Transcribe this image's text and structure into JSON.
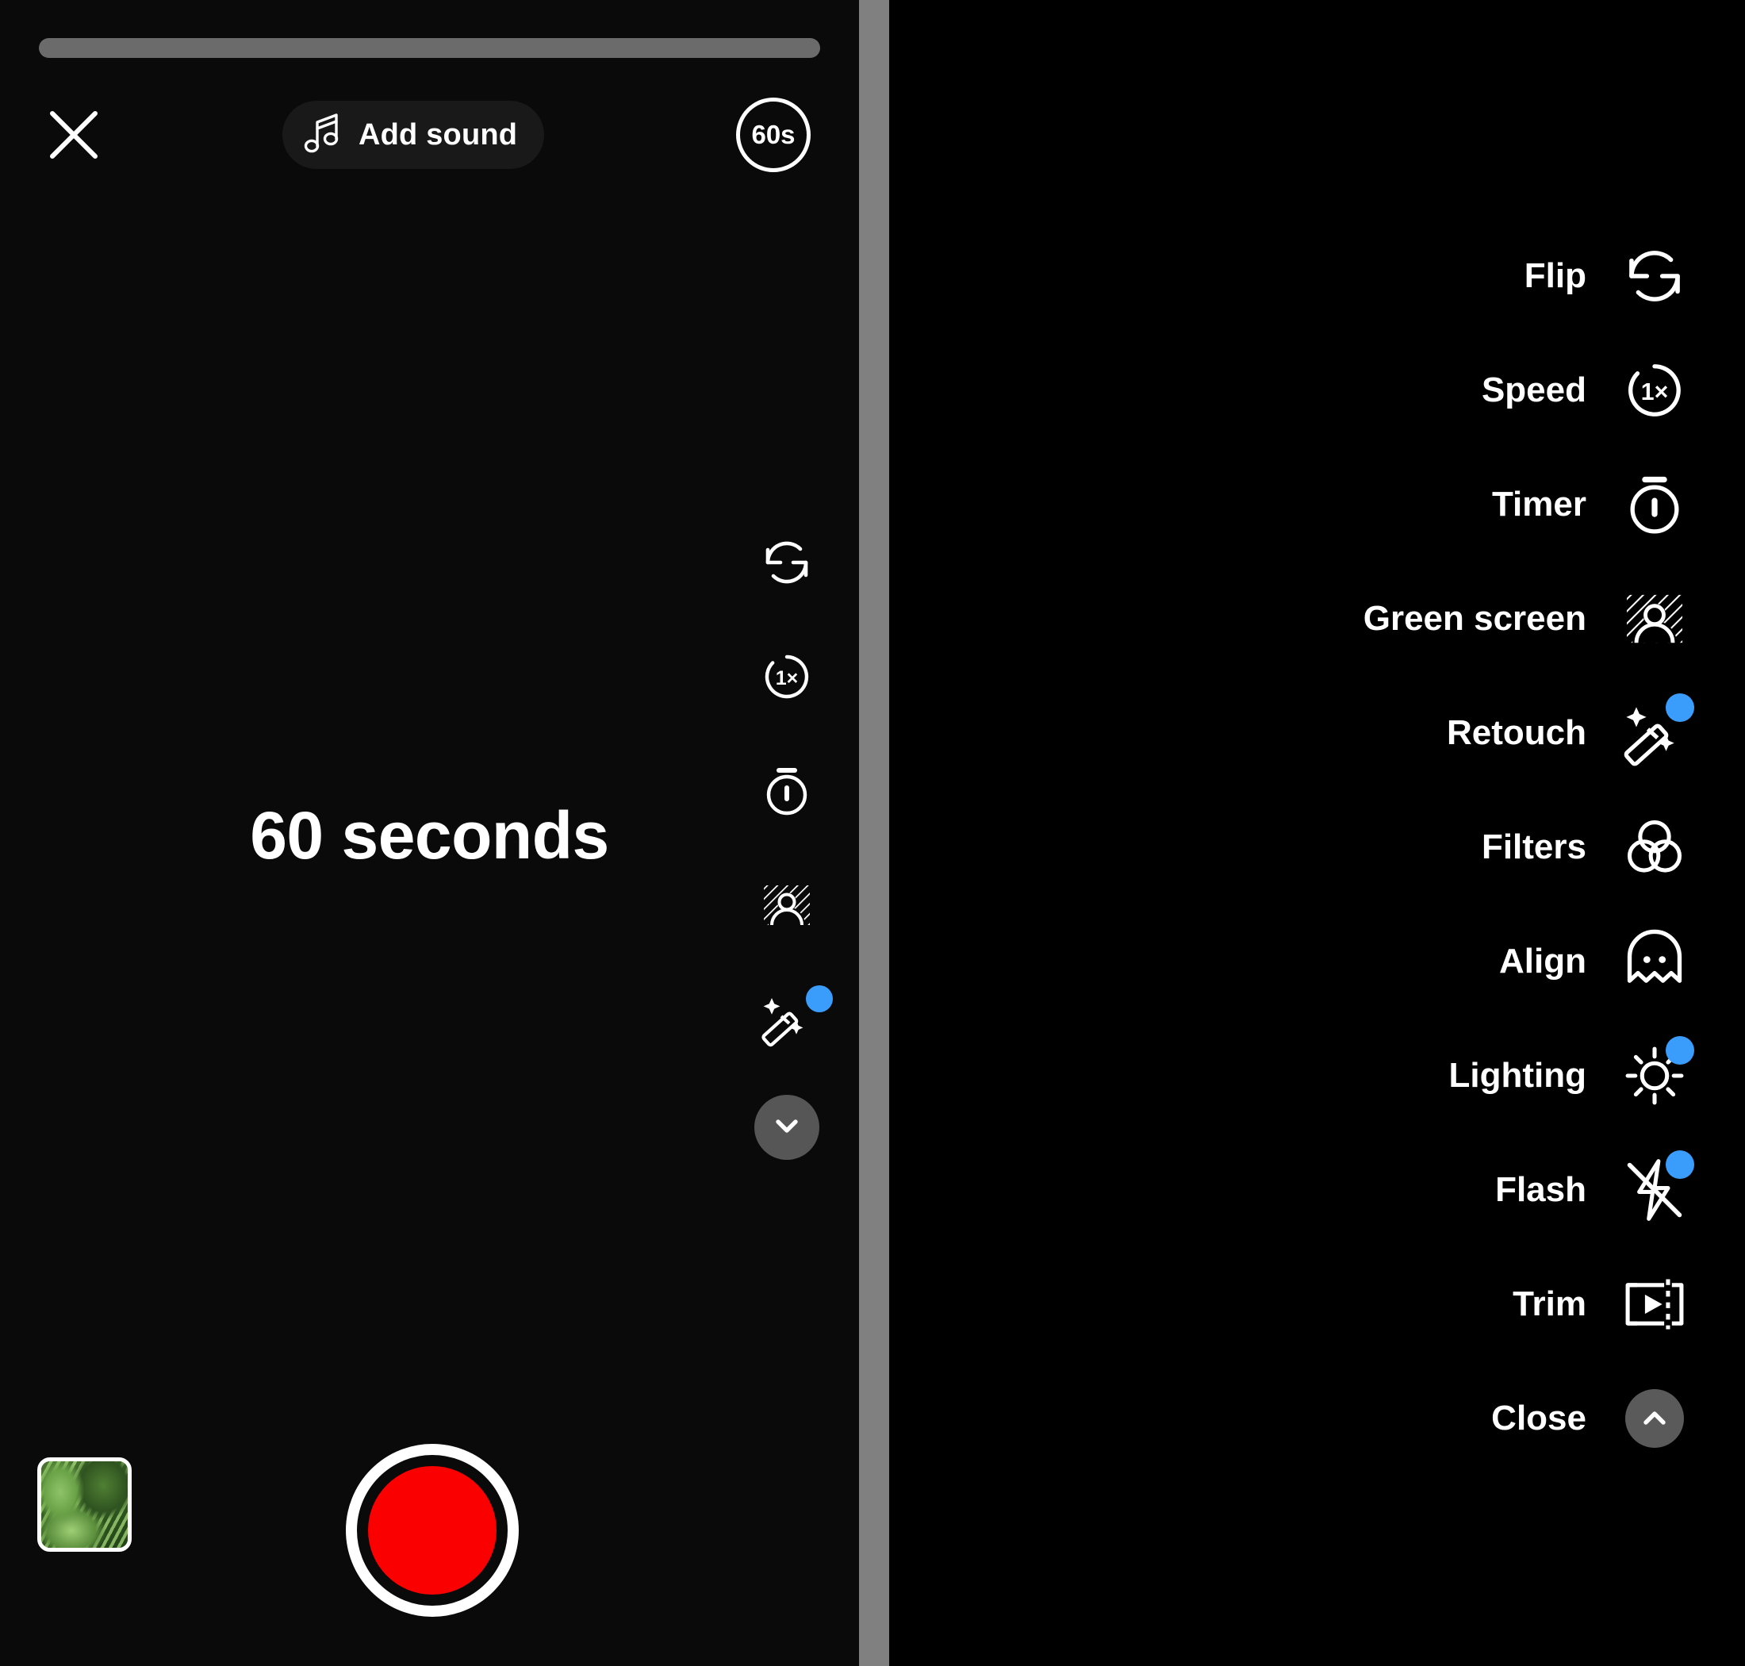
{
  "app": {
    "screen_name": "Camera recorder",
    "accent_badge_color": "#3b9dfb",
    "record_color": "#fa0000",
    "divider_color": "#808080"
  },
  "camera": {
    "progress": {
      "name": "recording-progress",
      "value_percent": 100,
      "track_color": "#6b6b6b"
    },
    "top_bar": {
      "close_label": "Close",
      "add_sound_label": "Add sound",
      "add_sound_icon": "music-note-icon",
      "duration_label": "60s"
    },
    "countdown_text": "60 seconds",
    "tool_strip": [
      {
        "name": "flip",
        "icon": "flip-camera-icon",
        "badge": false
      },
      {
        "name": "speed",
        "icon": "speed-1x-icon",
        "badge": false,
        "value": "1×"
      },
      {
        "name": "timer",
        "icon": "timer-icon",
        "badge": false
      },
      {
        "name": "green-screen",
        "icon": "green-screen-icon",
        "badge": false
      },
      {
        "name": "retouch",
        "icon": "magic-wand-icon",
        "badge": true
      }
    ],
    "collapse_button": {
      "name": "collapse-tools",
      "icon": "chevron-down-icon"
    },
    "bottom": {
      "gallery_thumbnail": "gallery-thumbnail-fern",
      "record_button": "record-button"
    }
  },
  "menu": {
    "items": [
      {
        "label": "Flip",
        "icon": "flip-camera-icon",
        "badge": false
      },
      {
        "label": "Speed",
        "icon": "speed-1x-icon",
        "badge": false,
        "value": "1×"
      },
      {
        "label": "Timer",
        "icon": "timer-icon",
        "badge": false
      },
      {
        "label": "Green screen",
        "icon": "green-screen-icon",
        "badge": false
      },
      {
        "label": "Retouch",
        "icon": "magic-wand-icon",
        "badge": true
      },
      {
        "label": "Filters",
        "icon": "filters-icon",
        "badge": false
      },
      {
        "label": "Align",
        "icon": "ghost-align-icon",
        "badge": false
      },
      {
        "label": "Lighting",
        "icon": "sun-brightness-icon",
        "badge": true
      },
      {
        "label": "Flash",
        "icon": "flash-off-icon",
        "badge": true
      },
      {
        "label": "Trim",
        "icon": "trim-clip-icon",
        "badge": false
      },
      {
        "label": "Close",
        "icon": "chevron-up-icon",
        "badge": false
      }
    ]
  }
}
